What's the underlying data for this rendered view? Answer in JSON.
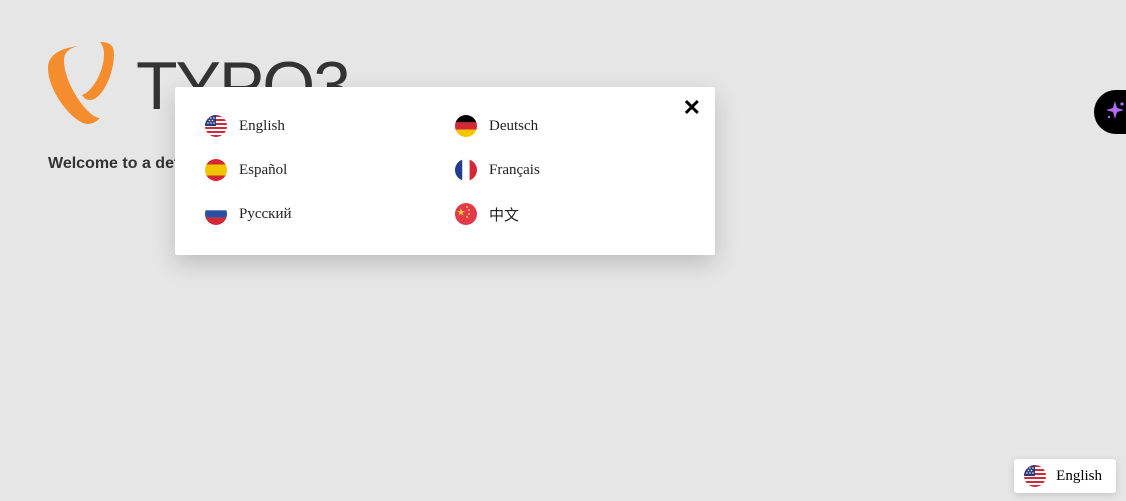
{
  "logo": {
    "text": "TYPO3"
  },
  "welcome": "Welcome to a def",
  "dialog": {
    "close_icon": "close-icon",
    "languages": [
      {
        "label": "English",
        "flag": "us"
      },
      {
        "label": "Deutsch",
        "flag": "de"
      },
      {
        "label": "Español",
        "flag": "es"
      },
      {
        "label": "Français",
        "flag": "fr"
      },
      {
        "label": "Русский",
        "flag": "ru"
      },
      {
        "label": "中文",
        "flag": "cn"
      }
    ]
  },
  "current_language": {
    "label": "English",
    "flag": "us"
  },
  "side_widget": {
    "icon": "sparkle-icon"
  }
}
